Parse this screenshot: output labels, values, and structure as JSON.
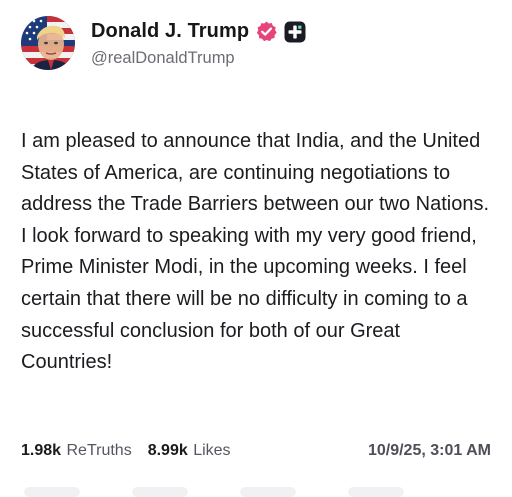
{
  "author": {
    "display_name": "Donald J. Trump",
    "handle": "@realDonaldTrump",
    "icons": [
      "avatar-flag-portrait",
      "verified-badge-icon",
      "plus-badge-icon"
    ],
    "verified_color": "#e6457a"
  },
  "post": {
    "text": "I am pleased to announce that India, and the United States of America, are continuing negotiations to address the Trade Barriers between our two Nations. I look forward to speaking with my very good friend, Prime Minister Modi, in the upcoming weeks. I feel certain that there will be no difficulty in coming to a successful conclusion for both of our Great Countries!"
  },
  "stats": {
    "retruths_count": "1.98k",
    "retruths_label": "ReTruths",
    "likes_count": "8.99k",
    "likes_label": "Likes",
    "timestamp": "10/9/25, 3:01 AM"
  }
}
